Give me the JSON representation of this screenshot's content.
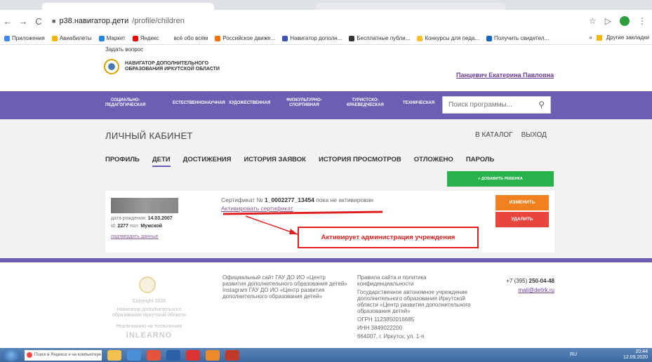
{
  "browser": {
    "url_host": "p38.навигатор.дети",
    "url_path": "/profile/children",
    "bookmarks": [
      {
        "label": "Приложения",
        "color": "#4285f4"
      },
      {
        "label": "Авиабилеты",
        "color": "#f4b400"
      },
      {
        "label": "Маркет",
        "color": "#1e88e5"
      },
      {
        "label": "Яндекс",
        "color": "#ff0000"
      },
      {
        "label": "всё обо всём",
        "color": "#ffffff"
      },
      {
        "label": "Российское движе...",
        "color": "#ff6f00"
      },
      {
        "label": "Навигатор дополн...",
        "color": "#3f51b5"
      },
      {
        "label": "Бесплатные публи...",
        "color": "#333333"
      },
      {
        "label": "Конкурсы для педа...",
        "color": "#fbc02d"
      },
      {
        "label": "Получить свидетел...",
        "color": "#1565c0"
      }
    ],
    "other_bookmarks": "Другие закладки"
  },
  "header": {
    "ask_question": "Задать вопрос",
    "logo_line1": "НАВИГАТОР ДОПОЛНИТЕЛЬНОГО",
    "logo_line2": "ОБРАЗОВАНИЯ ИРКУТСКОЙ ОБЛАСТИ",
    "user_name": "Панцевич Екатерина Павловна"
  },
  "nav": {
    "items": [
      {
        "line1": "СОЦИАЛЬНО-",
        "line2": "ПЕДАГОГИЧЕСКАЯ"
      },
      {
        "line1": "ЕСТЕСТВЕННОНАУЧНАЯ",
        "line2": ""
      },
      {
        "line1": "ХУДОЖЕСТВЕННАЯ",
        "line2": ""
      },
      {
        "line1": "ФИЗКУЛЬТУРНО-",
        "line2": "СПОРТИВНАЯ"
      },
      {
        "line1": "ТУРИСТСКО-",
        "line2": "КРАЕВЕДЧЕСКАЯ"
      },
      {
        "line1": "ТЕХНИЧЕСКАЯ",
        "line2": ""
      }
    ],
    "search_placeholder": "Поиск программы..."
  },
  "cabinet": {
    "title": "ЛИЧНЫЙ КАБИНЕТ",
    "catalog_link": "В КАТАЛОГ",
    "exit_link": "ВЫХОД",
    "tabs": [
      "ПРОФИЛЬ",
      "ДЕТИ",
      "ДОСТИЖЕНИЯ",
      "ИСТОРИЯ ЗАЯВОК",
      "ИСТОРИЯ ПРОСМОТРОВ",
      "ОТЛОЖЕНО",
      "ПАРОЛЬ"
    ],
    "active_tab": "ДЕТИ",
    "add_child": "+ ДОБАВИТЬ РЕБЕНКА"
  },
  "child": {
    "birth_label": "дата рождения:",
    "birth_date": "14.03.2007",
    "id_label": "id:",
    "id_value": "2277",
    "gender_label": "пол:",
    "gender_value": "Мужской",
    "confirm_link": "подтвердить данные",
    "cert_prefix": "Сертификат №",
    "cert_number": "1_0002277_13454",
    "cert_status": "пока не активирован",
    "activate_link": "Активировать сертификат",
    "change_button": "ИЗМЕНИТЬ",
    "delete_button": "УДАЛИТЬ"
  },
  "annotation": {
    "text": "Активирует администрация учреждения",
    "color": "#e02020"
  },
  "footer": {
    "copyright": "Copyright 2020",
    "org_short": "Навигатор дополнительного образования Иркутской области",
    "tech": "Реализовано на технологиях",
    "brand": "iNLEARNO",
    "official_site": "Официальный сайт ГАУ ДО ИО «Центр развития дополнительного образования детей»",
    "instagram": "Instagram ГАУ ДО ИО «Центр развития дополнительного образования детей»",
    "policy": "Правила сайта и политика конфиденциальности",
    "org_full": "Государственное автономное учреждение дополнительного образования Иркутской области «Центр развития дополнительного образования детей»",
    "ogrn": "ОГРН 1123850016685",
    "inn": "ИНН 3849022200",
    "address": "664007, г. Иркутск, ул. 1-я",
    "phone_prefix": "+7 (395)",
    "phone_number": "250-04-48",
    "email": "mail@detirk.ru"
  },
  "taskbar": {
    "search_text": "Поиск в Яндексе и на компьютере",
    "lang": "RU",
    "time": "20:44",
    "date": "12.09.2020"
  },
  "colors": {
    "brand_purple": "#6b5fb3",
    "add_green": "#27b24b",
    "change_orange": "#f08020",
    "delete_red": "#e8453c"
  }
}
